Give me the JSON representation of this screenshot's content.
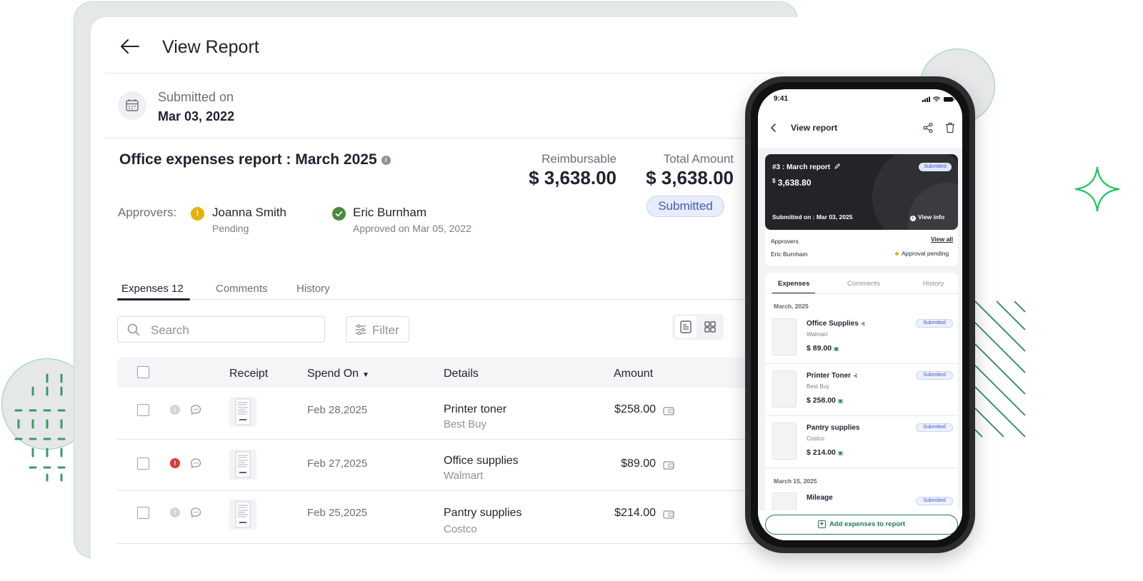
{
  "desktop": {
    "page_title": "View Report",
    "submitted_label": "Submitted on",
    "submitted_date": "Mar 03, 2022",
    "report_title": "Office expenses report : March 2025",
    "reimbursable_label": "Reimbursable",
    "reimbursable_value": "$ 3,638.00",
    "total_label": "Total Amount",
    "total_value": "$ 3,638.00",
    "status": "Submitted",
    "approvers_label": "Approvers:",
    "approvers": [
      {
        "name": "Joanna Smith",
        "status": "Pending",
        "icon": "warning-icon",
        "color": "#e8b007"
      },
      {
        "name": "Eric Burnham",
        "status": "Approved on Mar 05, 2022",
        "icon": "check-icon",
        "color": "#4a8a3c"
      }
    ],
    "tabs": [
      {
        "label": "Expenses 12",
        "active": true
      },
      {
        "label": "Comments",
        "active": false
      },
      {
        "label": "History",
        "active": false
      }
    ],
    "search_placeholder": "Search",
    "filter_label": "Filter",
    "table": {
      "headers": {
        "receipt": "Receipt",
        "spend_on": "Spend On",
        "details": "Details",
        "amount": "Amount"
      },
      "rows": [
        {
          "date": "Feb 28,2025",
          "title": "Printer toner",
          "merchant": "Best Buy",
          "amount": "$258.00",
          "flag": "info"
        },
        {
          "date": "Feb 27,2025",
          "title": "Office supplies",
          "merchant": "Walmart",
          "amount": "$89.00",
          "flag": "error"
        },
        {
          "date": "Feb 25,2025",
          "title": "Pantry supplies",
          "merchant": "Costco",
          "amount": "$214.00",
          "flag": "info"
        }
      ]
    }
  },
  "mobile": {
    "time": "9:41",
    "title": "View report",
    "report_name": "#3 : March report",
    "status": "Submitted",
    "currency": "$",
    "amount": "3,638.80",
    "submitted_on": "Submitted on : Mar 03, 2025",
    "view_info": "View info",
    "approvers_label": "Approvers",
    "view_all": "View all",
    "approver_name": "Eric Burnham",
    "approval_status": "Approval pending",
    "tabs": [
      "Expenses",
      "Comments",
      "History"
    ],
    "group1": "March, 2025",
    "items": [
      {
        "name": "Office Supplies",
        "merchant": "Walmart",
        "amount": "89.00",
        "status": "Submitted"
      },
      {
        "name": "Printer Toner",
        "merchant": "Best Buy",
        "amount": "258.00",
        "status": "Submitted"
      },
      {
        "name": "Pantry supplies",
        "merchant": "Costco",
        "amount": "214.00",
        "status": "Submitted"
      }
    ],
    "group2": "March 15, 2025",
    "item4": {
      "name": "Mileage",
      "status": "Submitted"
    },
    "add_button": "Add expenses to report"
  },
  "colors": {
    "accent_green": "#1e7a4f",
    "submitted_blue": "#3d59c7",
    "dark_card": "#232427"
  }
}
